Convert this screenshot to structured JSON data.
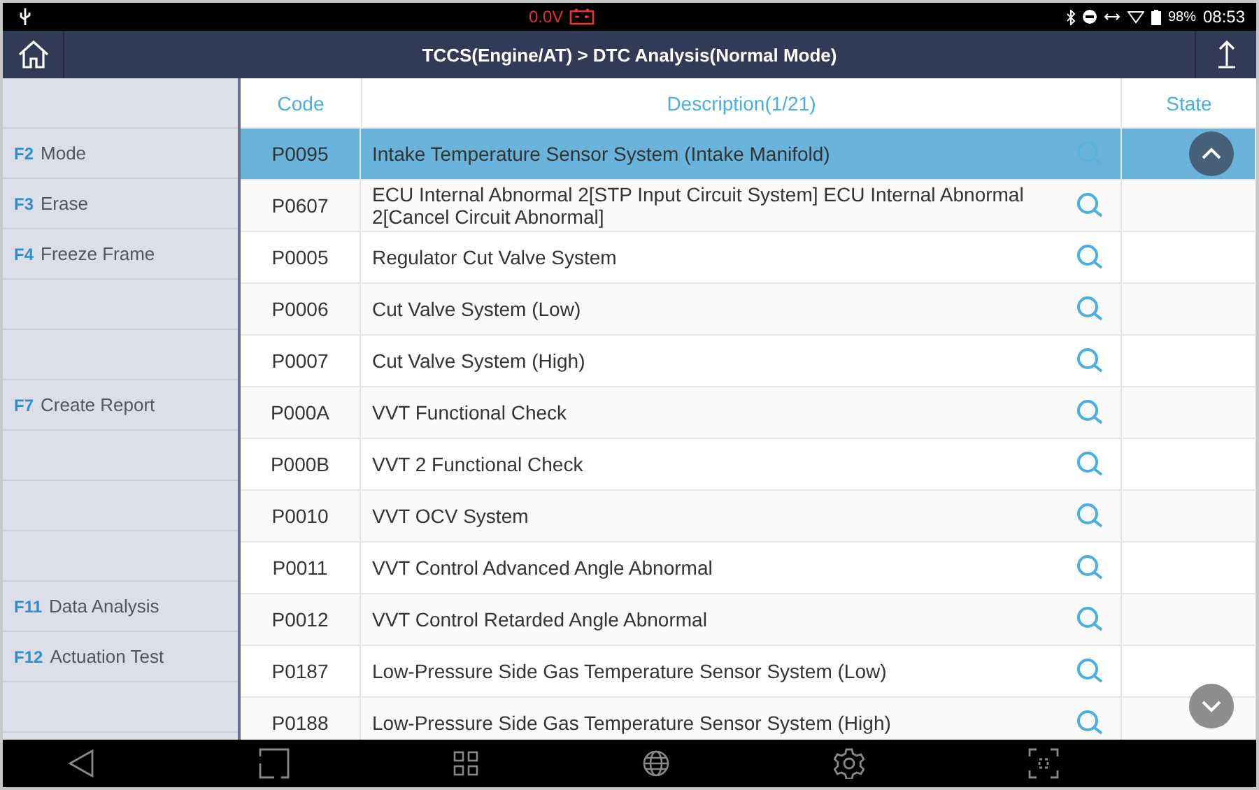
{
  "status_bar": {
    "voltage": "0.0V",
    "battery": "98%",
    "time": "08:53"
  },
  "title_bar": {
    "title": "TCCS(Engine/AT)  > DTC Analysis(Normal Mode)"
  },
  "sidebar": {
    "items": [
      {
        "kind": "empty"
      },
      {
        "kind": "function",
        "key": "F2",
        "label": "Mode"
      },
      {
        "kind": "function",
        "key": "F3",
        "label": "Erase"
      },
      {
        "kind": "function",
        "key": "F4",
        "label": "Freeze Frame"
      },
      {
        "kind": "empty"
      },
      {
        "kind": "empty"
      },
      {
        "kind": "function",
        "key": "F7",
        "label": "Create Report"
      },
      {
        "kind": "empty"
      },
      {
        "kind": "empty"
      },
      {
        "kind": "empty"
      },
      {
        "kind": "function",
        "key": "F11",
        "label": "Data Analysis"
      },
      {
        "kind": "function",
        "key": "F12",
        "label": "Actuation Test"
      },
      {
        "kind": "empty"
      }
    ]
  },
  "table": {
    "columns": [
      "Code",
      "Description(1/21)",
      "State"
    ],
    "rows": [
      {
        "code": "P0095",
        "description": "Intake Temperature Sensor System (Intake Manifold)",
        "selected": true
      },
      {
        "code": "P0607",
        "description": "ECU Internal Abnormal 2[STP Input Circuit System] ECU Internal Abnormal 2[Cancel Circuit Abnormal]",
        "selected": false
      },
      {
        "code": "P0005",
        "description": "Regulator Cut Valve System",
        "selected": false
      },
      {
        "code": "P0006",
        "description": "Cut Valve System (Low)",
        "selected": false
      },
      {
        "code": "P0007",
        "description": "Cut Valve System (High)",
        "selected": false
      },
      {
        "code": "P000A",
        "description": "VVT Functional Check",
        "selected": false
      },
      {
        "code": "P000B",
        "description": "VVT 2 Functional Check",
        "selected": false
      },
      {
        "code": "P0010",
        "description": "VVT OCV System",
        "selected": false
      },
      {
        "code": "P0011",
        "description": "VVT Control Advanced Angle Abnormal",
        "selected": false
      },
      {
        "code": "P0012",
        "description": "VVT Control Retarded Angle Abnormal",
        "selected": false
      },
      {
        "code": "P0187",
        "description": "Low-Pressure Side Gas Temperature Sensor System (Low)",
        "selected": false
      },
      {
        "code": "P0188",
        "description": "Low-Pressure Side Gas Temperature Sensor System (High)",
        "selected": false
      }
    ]
  }
}
